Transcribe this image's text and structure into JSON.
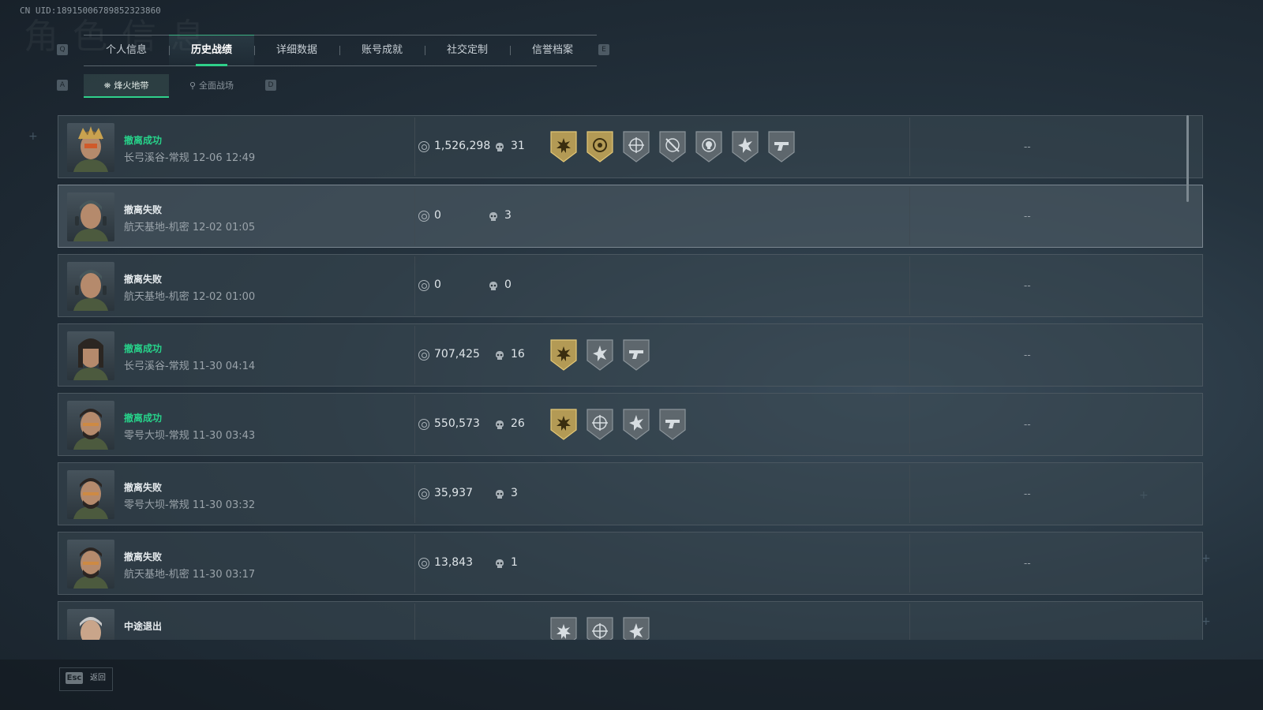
{
  "uid": "CN UID:18915006789852323860",
  "bg_title": "角色信息",
  "keys": {
    "tab_left": "Q",
    "tab_right": "E",
    "sub_left": "A",
    "sub_right": "D"
  },
  "tabs": [
    {
      "label": "个人信息",
      "active": false
    },
    {
      "label": "历史战绩",
      "active": true
    },
    {
      "label": "详细数据",
      "active": false
    },
    {
      "label": "账号成就",
      "active": false
    },
    {
      "label": "社交定制",
      "active": false
    },
    {
      "label": "信誉档案",
      "active": false
    }
  ],
  "subtabs": [
    {
      "label": "烽火地带",
      "active": true,
      "icon": "target-icon"
    },
    {
      "label": "全面战场",
      "active": false,
      "icon": "antenna-icon"
    }
  ],
  "colors": {
    "accent": "#2fd08a",
    "success": "#27d28a",
    "gold_badge": "#b39a55",
    "grey_badge": "#5e676d"
  },
  "records": [
    {
      "status": "撤离成功",
      "status_type": "ok",
      "map": "长弓溪谷-常规 12-06 12:49",
      "value": "1,526,298",
      "kills": "31",
      "extra": "--",
      "avatar": "crown-helmet-operator",
      "badges": [
        {
          "type": "gold",
          "icon": "sunburst-icon"
        },
        {
          "type": "gold",
          "icon": "target-ring-icon"
        },
        {
          "type": "grey",
          "icon": "crosshair-icon"
        },
        {
          "type": "grey",
          "icon": "crosshair-slash-icon"
        },
        {
          "type": "grey",
          "icon": "skull-target-icon"
        },
        {
          "type": "grey",
          "icon": "star-burst-icon"
        },
        {
          "type": "grey",
          "icon": "pistol-icon"
        }
      ]
    },
    {
      "status": "撤离失败",
      "status_type": "fail",
      "map": "航天基地-机密 12-02 01:05",
      "value": "0",
      "kills": "3",
      "extra": "--",
      "avatar": "cap-headset-operator",
      "badges": []
    },
    {
      "status": "撤离失败",
      "status_type": "fail",
      "map": "航天基地-机密 12-02 01:00",
      "value": "0",
      "kills": "0",
      "extra": "--",
      "avatar": "cap-headset-operator",
      "badges": []
    },
    {
      "status": "撤离成功",
      "status_type": "ok",
      "map": "长弓溪谷-常规 11-30 04:14",
      "value": "707,425",
      "kills": "16",
      "extra": "--",
      "avatar": "female-operator",
      "badges": [
        {
          "type": "gold",
          "icon": "sunburst-icon"
        },
        {
          "type": "grey",
          "icon": "star-burst-icon"
        },
        {
          "type": "grey",
          "icon": "pistol-icon"
        }
      ]
    },
    {
      "status": "撤离成功",
      "status_type": "ok",
      "map": "零号大坝-常规 11-30 03:43",
      "value": "550,573",
      "kills": "26",
      "extra": "--",
      "avatar": "bearded-operator",
      "badges": [
        {
          "type": "gold",
          "icon": "sunburst-icon"
        },
        {
          "type": "grey",
          "icon": "crosshair-icon"
        },
        {
          "type": "grey",
          "icon": "star-burst-icon"
        },
        {
          "type": "grey",
          "icon": "pistol-icon"
        }
      ]
    },
    {
      "status": "撤离失败",
      "status_type": "fail",
      "map": "零号大坝-常规 11-30 03:32",
      "value": "35,937",
      "kills": "3",
      "extra": "--",
      "avatar": "bearded-operator",
      "badges": []
    },
    {
      "status": "撤离失败",
      "status_type": "fail",
      "map": "航天基地-机密 11-30 03:17",
      "value": "13,843",
      "kills": "1",
      "extra": "--",
      "avatar": "bearded-operator",
      "badges": []
    },
    {
      "status": "中途退出",
      "status_type": "quit",
      "map": "",
      "value": "",
      "kills": "",
      "extra": "",
      "avatar": "grey-hair-operator",
      "badges": [
        {
          "type": "grey",
          "icon": "sunburst-icon"
        },
        {
          "type": "grey",
          "icon": "crosshair-icon"
        },
        {
          "type": "grey",
          "icon": "star-burst-icon"
        }
      ]
    }
  ],
  "footer": {
    "esc_key": "Esc",
    "back_label": "返回"
  }
}
